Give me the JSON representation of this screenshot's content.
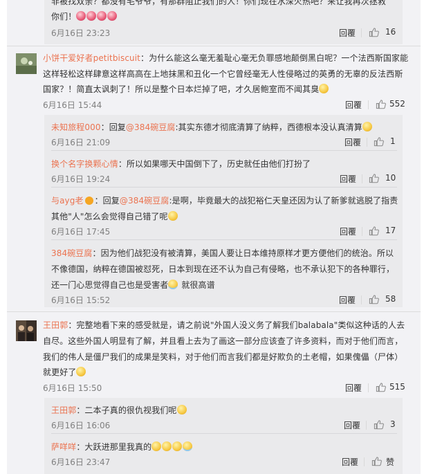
{
  "actions": {
    "reply": "回覆"
  },
  "top": {
    "line1": "非被找双亲？都没有毛爷爷，有那群阻止我们的人！你们现在水深火热吧？来让我再次拯救",
    "line2": "你们！",
    "time": "6月16日 23:23",
    "likes": "16"
  },
  "c1": {
    "user": "小饼干爱好者petitbiscuit",
    "text1": "：为什么能这么毫无羞耻心毫无负罪感地颠倒黑白呢？一个法西斯国家能",
    "line2": "这样轻松这样肆意这样高高在上地抹黑和丑化一个它曾经毫无人性侵略过的英勇的无辜的反法西斯",
    "line3": "国家？！简直太讽刺了！所以是整个日本烂掉了吧，才久居鲍室而不闻其臭",
    "time": "6月16日 15:44",
    "likes": "552"
  },
  "r1": {
    "user": "未知旅程000",
    "pre": "：回复",
    "at": "@384碗豆腐",
    "text": ":其实东德才彻底清算了纳粹，西德根本没认真清算",
    "time": "6月16日 21:09",
    "likes": "1"
  },
  "r2": {
    "user": "换个名字换颗心情",
    "text": "：所以如果哪天中国倒下了，历史就任由他们打扮了",
    "time": "6月16日 19:24",
    "likes": "10"
  },
  "r3": {
    "user": "与ayg老",
    "pre": "：回复",
    "at": "@384碗豆腐",
    "text": ":是啊，毕竟最大的战犯裕仁天皇还因为认了新爹就逃脱了指责",
    "line2": "其他\"人\"怎么会觉得自己错了呢",
    "time": "6月16日 17:45",
    "likes": "17"
  },
  "r4": {
    "user": "384碗豆腐",
    "text": "：因为他们战犯没有被清算，美国人要让日本维持原样才更方便他们的统治。所以",
    "line2": "不像德国，纳粹在德国被怼死，日本到现在还不认为自己有侵略，也不承认犯下的各种罪行，",
    "line3": "还一门心思觉得自己也是受害者",
    "tail": "就很高谱",
    "time": "6月16日 15:52",
    "likes": "58"
  },
  "c2": {
    "user": "王田郭",
    "text1": "：完整地看下来的感受就是，请之前说\"外国人没义务了解我们balabala\"类似这种话的人去",
    "line2": "自尽。这些外国人明显有了解，并且看上去为了画这一部分应该查了许多资料，而对于他们而言，",
    "line3": "我们的伟人是僵尸我们的成果是笑料，对于他们而言我们都是好欺负的土老帽，如果傀儡（尸体）",
    "line4": "就更好了",
    "time": "6月16日 15:50",
    "likes": "515"
  },
  "r5": {
    "user": "王田郭",
    "text": "：二本子真的很仇视我们呢",
    "time": "6月16日 16:06",
    "likes": "3"
  },
  "r6": {
    "user": "萨咩咩",
    "text": "：大跃进那里我真的",
    "time": "6月16日 23:47",
    "likes": "赞"
  }
}
